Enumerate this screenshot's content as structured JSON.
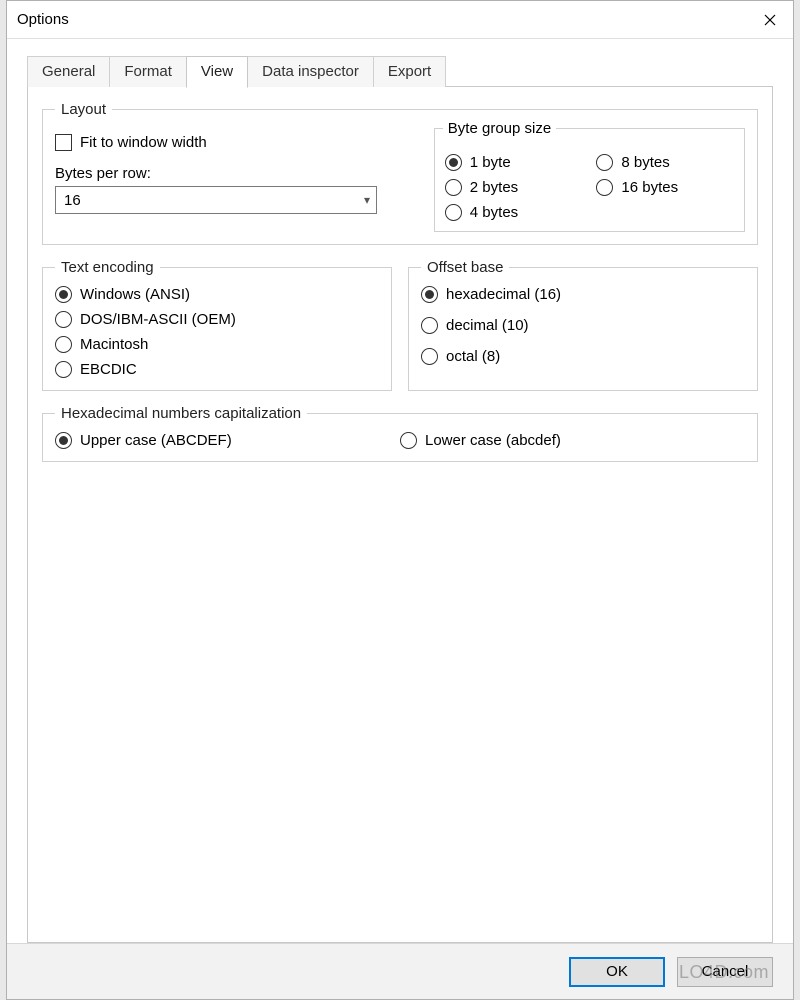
{
  "window": {
    "title": "Options",
    "close_icon": "close"
  },
  "tabs": [
    {
      "label": "General",
      "active": false
    },
    {
      "label": "Format",
      "active": false
    },
    {
      "label": "View",
      "active": true
    },
    {
      "label": "Data inspector",
      "active": false
    },
    {
      "label": "Export",
      "active": false
    }
  ],
  "layout": {
    "legend": "Layout",
    "fit_checkbox": {
      "label": "Fit to window width",
      "checked": false
    },
    "bytes_per_row": {
      "label": "Bytes per row:",
      "value": "16"
    },
    "byte_group": {
      "legend": "Byte group size",
      "options": [
        {
          "label": "1 byte",
          "selected": true
        },
        {
          "label": "8 bytes",
          "selected": false
        },
        {
          "label": "2 bytes",
          "selected": false
        },
        {
          "label": "16 bytes",
          "selected": false
        },
        {
          "label": "4 bytes",
          "selected": false
        }
      ]
    }
  },
  "text_encoding": {
    "legend": "Text encoding",
    "options": [
      {
        "label": "Windows (ANSI)",
        "selected": true
      },
      {
        "label": "DOS/IBM-ASCII (OEM)",
        "selected": false
      },
      {
        "label": "Macintosh",
        "selected": false
      },
      {
        "label": "EBCDIC",
        "selected": false
      }
    ]
  },
  "offset_base": {
    "legend": "Offset base",
    "options": [
      {
        "label": "hexadecimal (16)",
        "selected": true
      },
      {
        "label": "decimal (10)",
        "selected": false
      },
      {
        "label": "octal (8)",
        "selected": false
      }
    ]
  },
  "hex_caps": {
    "legend": "Hexadecimal numbers capitalization",
    "options": [
      {
        "label": "Upper case (ABCDEF)",
        "selected": true
      },
      {
        "label": "Lower case (abcdef)",
        "selected": false
      }
    ]
  },
  "buttons": {
    "ok": "OK",
    "cancel": "Cancel"
  },
  "watermark": "LO4D.com"
}
